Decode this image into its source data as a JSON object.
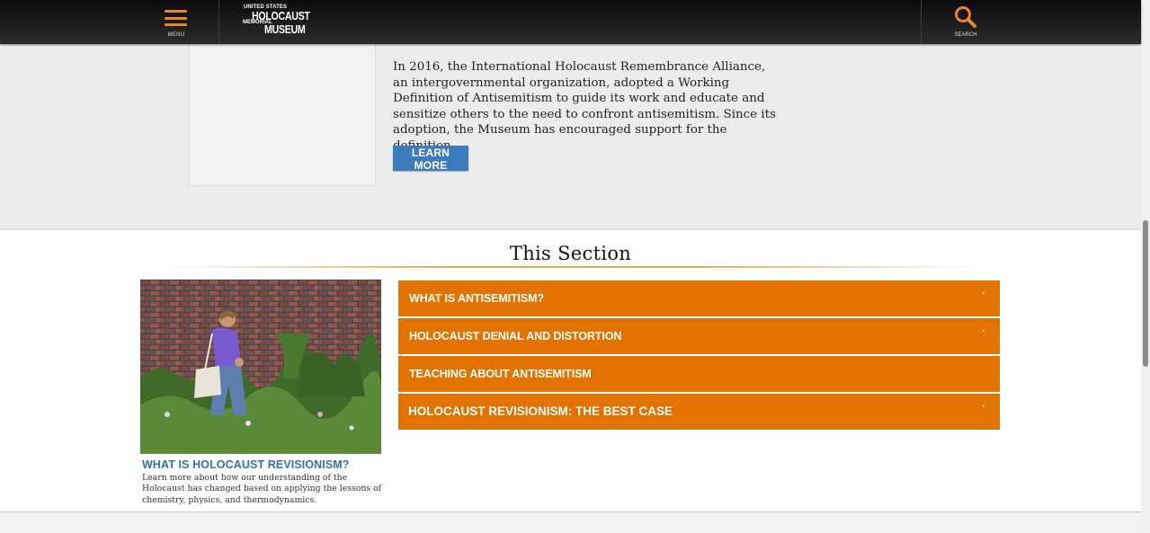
{
  "header": {
    "menu_label": "MENU",
    "logo": {
      "line1": "UNITED STATES",
      "line2": "HOLOCAUST",
      "line3": "MEMORIAL",
      "line4": "MUSEUM"
    },
    "search_label": "SEARCH",
    "menu_icon": "hamburger-icon",
    "search_icon": "search-icon",
    "accent_color": "#e9842c"
  },
  "intro": {
    "text": "In 2016, the International Holocaust Remembrance Alliance, an intergovernmental organization, adopted a Working Definition of Antisemitism to guide its work and educate and sensitize others to the need to confront antisemitism. Since its adoption, the Museum has encouraged support for the definition.",
    "button_label": "LEARN MORE",
    "button_color": "#3d7bbf"
  },
  "section": {
    "title": "This Section",
    "feature": {
      "title": "WHAT IS HOLOCAUST REVISIONISM?",
      "description": "Learn more about how our understanding of the Holocaust has changed based on applying the lessons of chemistry, physics, and thermodynamics."
    },
    "accordion_color": "#e27300",
    "accordion": [
      {
        "label": "WHAT IS ANTISEMITISM?",
        "chevron": true
      },
      {
        "label": "HOLOCAUST DENIAL AND DISTORTION",
        "chevron": true
      },
      {
        "label": "TEACHING ABOUT ANTISEMITISM",
        "chevron": false
      },
      {
        "label": "HOLOCAUST REVISIONISM: THE BEST CASE",
        "chevron": true
      }
    ]
  }
}
